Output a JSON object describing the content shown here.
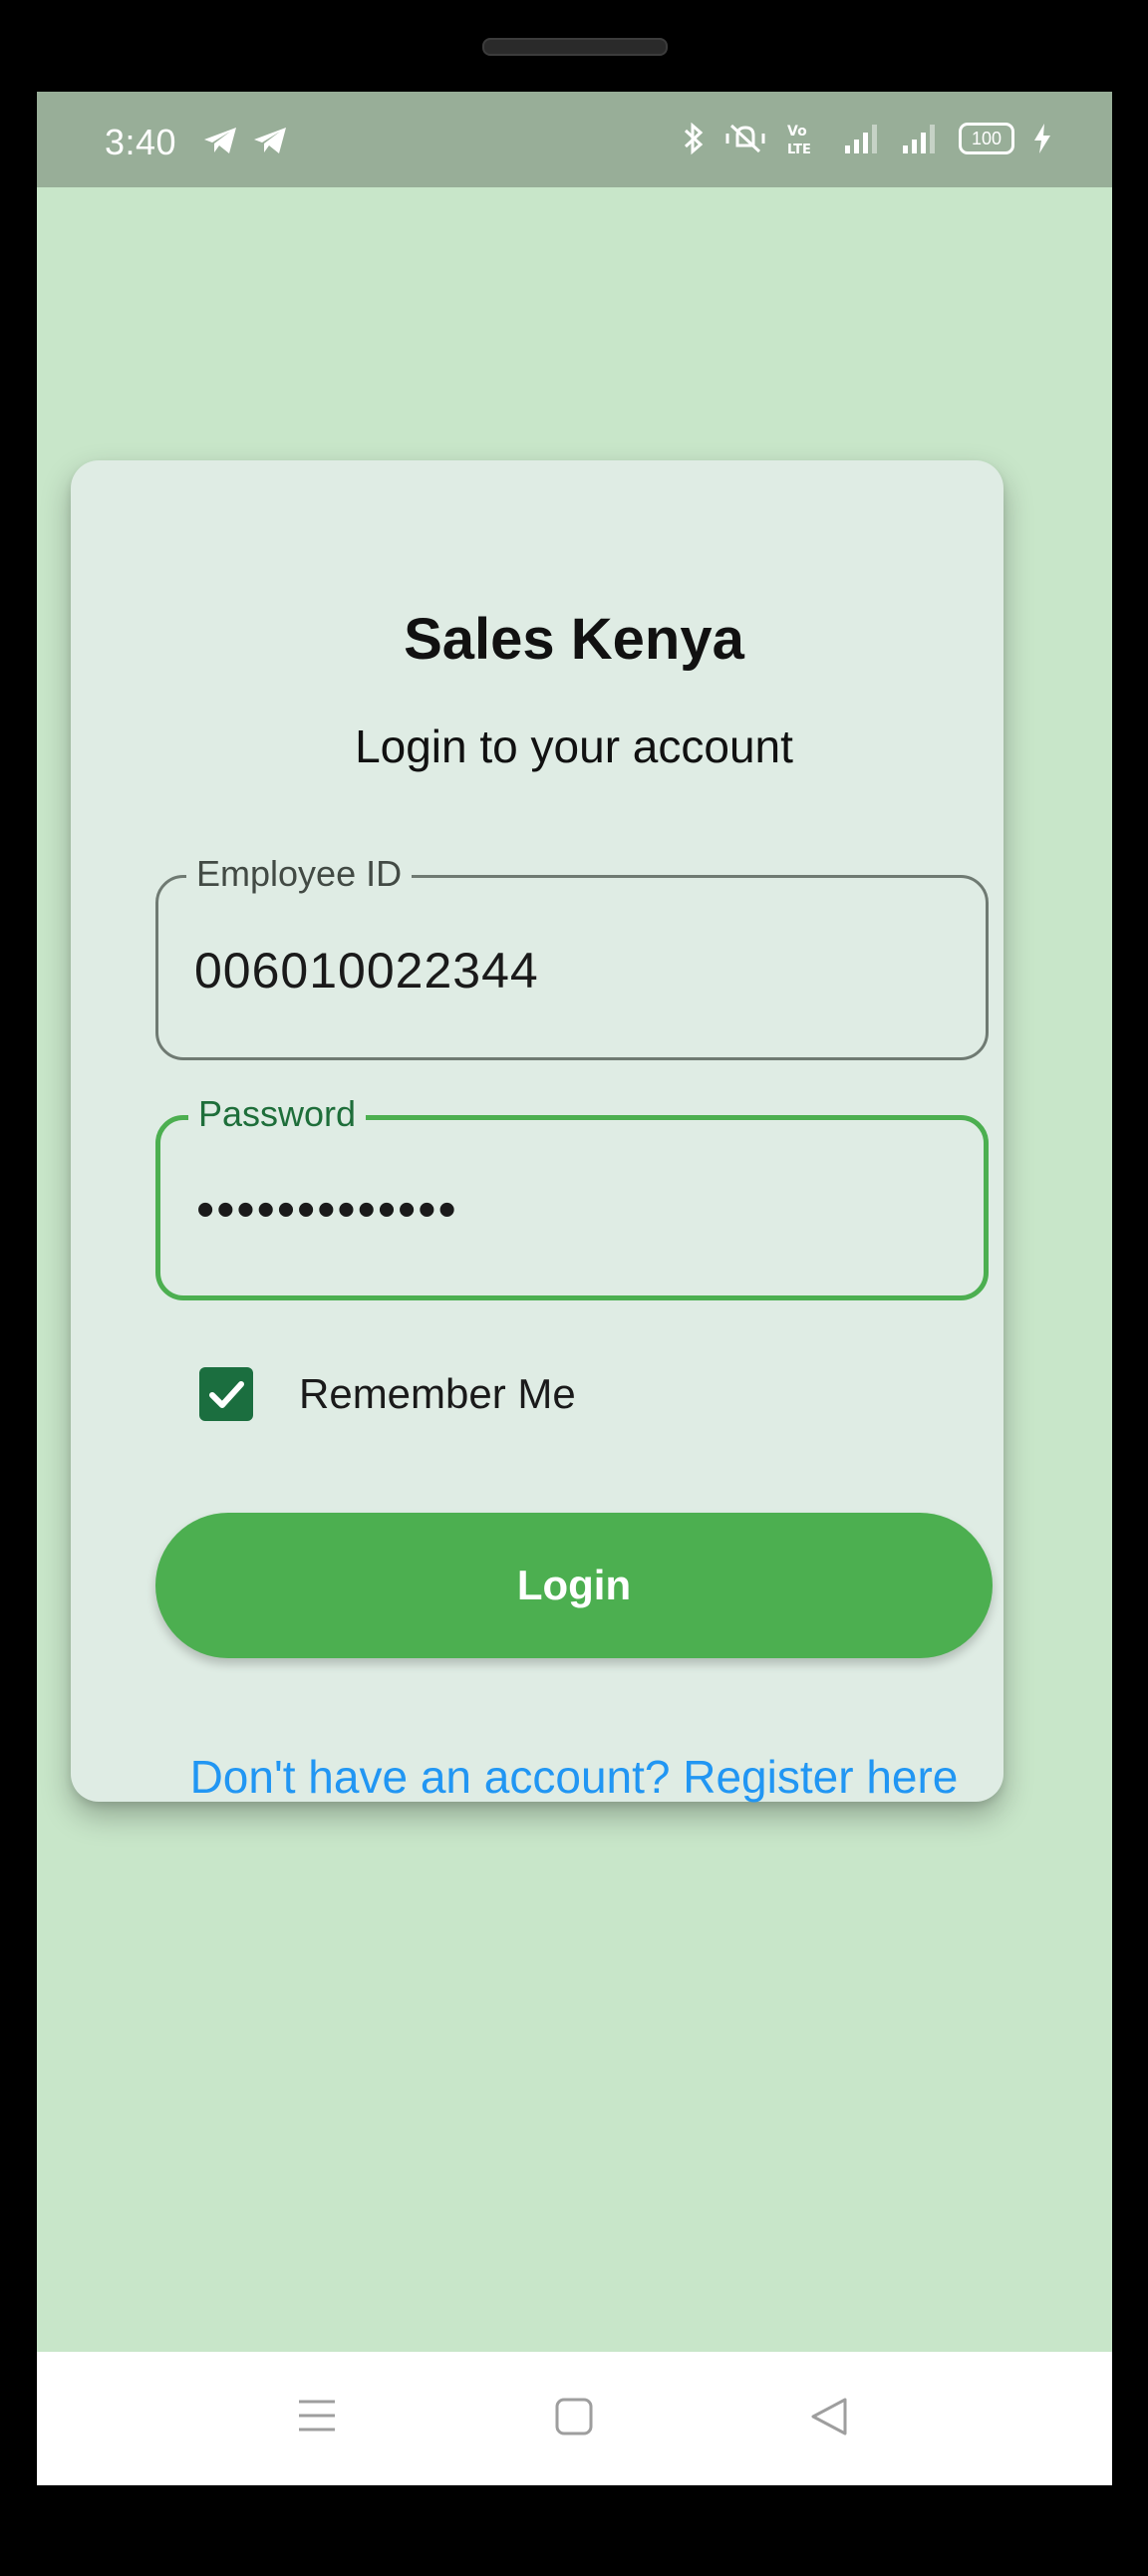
{
  "status_bar": {
    "time": "3:40",
    "left_icons": [
      "telegram-icon",
      "telegram-icon"
    ],
    "right_icons": [
      "bluetooth-icon",
      "vibrate-icon",
      "volte-icon",
      "signal-icon",
      "signal-icon",
      "battery-icon",
      "charging-icon"
    ],
    "battery_level": "100"
  },
  "login_card": {
    "title": "Sales Kenya",
    "subtitle": "Login to your account",
    "employee_id": {
      "label": "Employee ID",
      "value": "006010022344"
    },
    "password": {
      "label": "Password",
      "value": "•••••••••••••"
    },
    "remember_me": {
      "label": "Remember Me",
      "checked": true
    },
    "login_button": "Login",
    "register_link": "Don't have an account? Register here"
  },
  "nav_bar": {
    "icons": [
      "menu-icon",
      "home-icon",
      "back-icon"
    ]
  },
  "colors": {
    "screen_background": "#c8e6c9",
    "status_bar": "#98ae98",
    "card": "#dfece4",
    "accent_green": "#4caf50",
    "checkbox_green": "#1b6e3f",
    "link_blue": "#2196f3"
  }
}
